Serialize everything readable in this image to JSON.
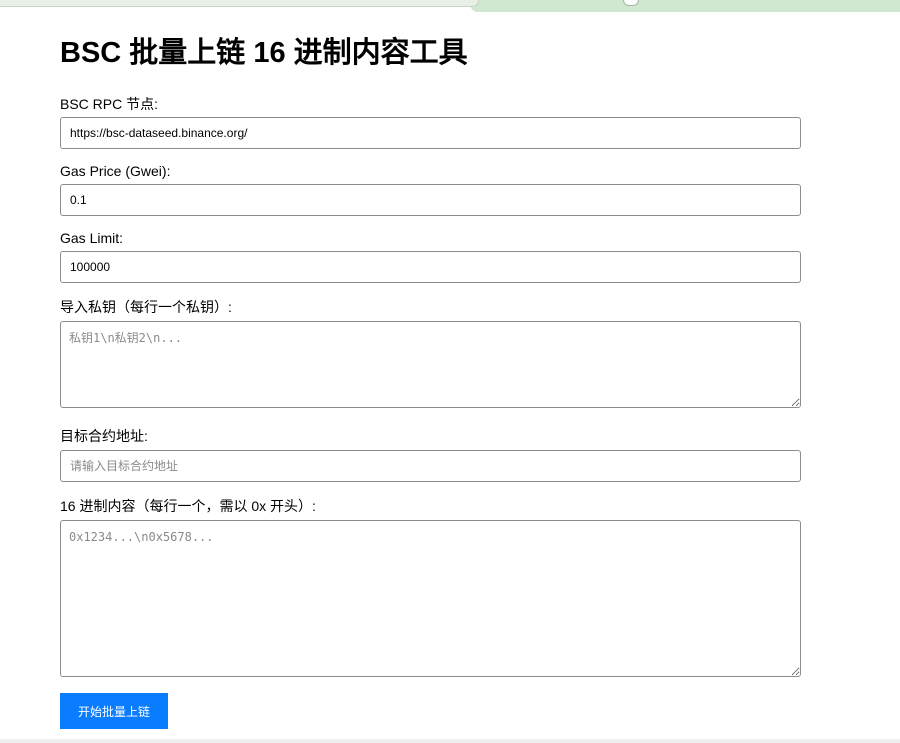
{
  "page": {
    "title": "BSC 批量上链 16 进制内容工具"
  },
  "form": {
    "rpc": {
      "label": "BSC RPC 节点:",
      "value": "https://bsc-dataseed.binance.org/"
    },
    "gas_price": {
      "label": "Gas Price (Gwei):",
      "value": "0.1"
    },
    "gas_limit": {
      "label": "Gas Limit:",
      "value": "100000"
    },
    "private_keys": {
      "label": "导入私钥（每行一个私钥）:",
      "placeholder": "私钥1\\n私钥2\\n...",
      "value": ""
    },
    "contract_address": {
      "label": "目标合约地址:",
      "placeholder": "请输入目标合约地址",
      "value": ""
    },
    "hex_content": {
      "label": "16 进制内容（每行一个，需以 0x 开头）:",
      "placeholder": "0x1234...\\n0x5678...",
      "value": ""
    },
    "submit_label": "开始批量上链"
  },
  "colors": {
    "primary_button": "#0a7cff",
    "browser_chrome_tab": "#cfe8cf"
  }
}
